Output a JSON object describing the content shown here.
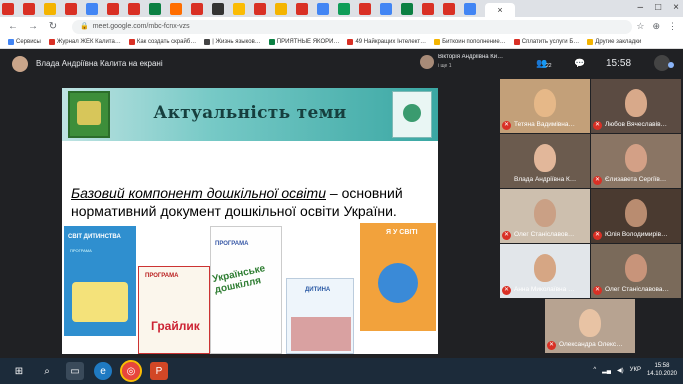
{
  "browser": {
    "active_tab_close": "×",
    "window_controls": [
      "–",
      "□",
      "×"
    ],
    "url": "meet.google.com/mbc-fcnx-vzs",
    "bookmarks": [
      {
        "label": "Сервисы",
        "color": "#4285f4"
      },
      {
        "label": "Журнал ЖЕК Калита…",
        "color": "#d93025"
      },
      {
        "label": "Как создать скрайб…",
        "color": "#d93025"
      },
      {
        "label": "| Жизнь языков…",
        "color": "#444"
      },
      {
        "label": "ПРИЯТНЫЕ ЯКОРИ…",
        "color": "#0b8043"
      },
      {
        "label": "49 Найкращих Iнтелект…",
        "color": "#d93025"
      },
      {
        "label": "Биткоин пополнение…",
        "color": "#f4b400"
      },
      {
        "label": "Сплатить услуги Б…",
        "color": "#d93025"
      },
      {
        "label": "Другие закладки",
        "color": "#f4b400"
      }
    ]
  },
  "meet": {
    "presenter_title": "Влада Андріївна Калита на екрані",
    "pinned_name": "Вікторія Андріївна Ки…",
    "pinned_sub": "і ще 1",
    "people_count": "22",
    "clock": "15:58"
  },
  "slide": {
    "title": "Актуальність теми",
    "text_underlined": "Базовий компонент дошкільної освіти",
    "text_rest": " – основний нормативний документ дошкільної освіти України.",
    "books": [
      {
        "title": "СВІТ ДИТИНСТВА",
        "subtitle": "ПРОГРАМА",
        "color": "#2f8fcf"
      },
      {
        "title": "ПРОГРАМА",
        "word": "Грайлик",
        "color": "#fbf6ec"
      },
      {
        "title": "ПРОГРАМА",
        "word": "Українське дошкілля",
        "color": "#fefefe"
      },
      {
        "title": "ДИТИНА",
        "color": "#eef5fb"
      },
      {
        "title": "Я У СВІТІ",
        "color": "#f2a23c"
      }
    ]
  },
  "participants": [
    {
      "name": "Тетяна Вадимівна…",
      "muted": true
    },
    {
      "name": "Любов Вячеславів…",
      "muted": true
    },
    {
      "name": "Влада Андріївна К…",
      "muted": false
    },
    {
      "name": "Єлизавета Сергіїв…",
      "muted": true
    },
    {
      "name": "Олег Станіславов…",
      "muted": true
    },
    {
      "name": "Юлія Володимирів…",
      "muted": true
    },
    {
      "name": "Анна Миколаївна …",
      "muted": true
    },
    {
      "name": "Олег Станіславова…",
      "muted": true
    },
    {
      "name": "Олександра Олекс…",
      "muted": true
    }
  ],
  "taskbar": {
    "time": "15:58",
    "date": "14.10.2020",
    "lang": "УКР"
  }
}
